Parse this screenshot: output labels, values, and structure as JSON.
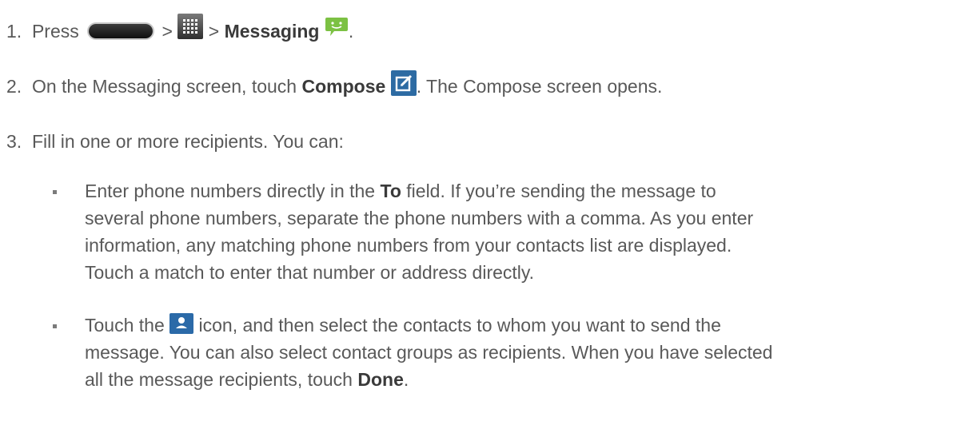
{
  "steps": {
    "s1": {
      "num": "1.",
      "press": "Press",
      "gt1": ">",
      "gt2": ">",
      "target": "Messaging",
      "end": "."
    },
    "s2": {
      "num": "2.",
      "pre": "On the Messaging screen, touch",
      "target": "Compose",
      "post": ". The Compose screen opens."
    },
    "s3": {
      "num": "3.",
      "text": "Fill in one or more recipients. You can:"
    }
  },
  "bullets": {
    "b1": {
      "l1_pre": "Enter phone numbers directly in the",
      "l1_bold": "To",
      "l1_post": "field. If you’re sending the message to",
      "l2": "several phone numbers, separate the phone numbers with a comma. As you enter",
      "l3": "information, any matching phone numbers from your contacts list are displayed.",
      "l4": "Touch a match to enter that number or address directly."
    },
    "b2": {
      "l1_pre": "Touch the",
      "l1_post": "icon, and then select the contacts to whom you want to send the",
      "l2": "message. You can also select contact groups as recipients. When you have selected",
      "l3_pre": "all the message recipients, touch",
      "l3_bold": "Done",
      "l3_end": "."
    }
  },
  "icons": {
    "home": "home-key-icon",
    "apps": "apps-grid-icon",
    "messaging": "messaging-icon",
    "compose": "compose-icon",
    "contact": "contact-icon"
  }
}
